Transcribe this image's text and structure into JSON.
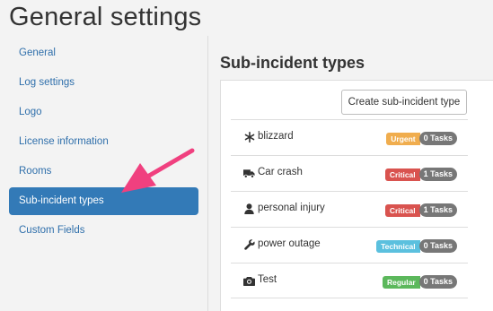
{
  "page": {
    "title": "General settings"
  },
  "sidebar": {
    "items": [
      {
        "label": "General"
      },
      {
        "label": "Log settings"
      },
      {
        "label": "Logo"
      },
      {
        "label": "License information"
      },
      {
        "label": "Rooms"
      },
      {
        "label": "Sub-incident types",
        "active": true
      },
      {
        "label": "Custom Fields"
      }
    ]
  },
  "main": {
    "section_title": "Sub-incident types",
    "create_button_label": "Create sub-incident type",
    "types": [
      {
        "icon": "snowflake-icon",
        "name": "blizzard",
        "priority": "Urgent",
        "priority_color": "#f0ad4e",
        "tasks": "0 Tasks"
      },
      {
        "icon": "truck-icon",
        "name": "Car crash",
        "priority": "Critical",
        "priority_color": "#d9534f",
        "tasks": "1 Tasks"
      },
      {
        "icon": "user-icon",
        "name": "personal injury",
        "priority": "Critical",
        "priority_color": "#d9534f",
        "tasks": "1 Tasks"
      },
      {
        "icon": "wrench-icon",
        "name": "power outage",
        "priority": "Technical",
        "priority_color": "#5bc0de",
        "tasks": "0 Tasks"
      },
      {
        "icon": "camera-icon",
        "name": "Test",
        "priority": "Regular",
        "priority_color": "#5cb85c",
        "tasks": "0 Tasks"
      }
    ]
  },
  "colors": {
    "link": "#2f6fab",
    "active_nav": "#337ab7",
    "task_badge": "#777777",
    "annotation_arrow": "#f0407f"
  }
}
